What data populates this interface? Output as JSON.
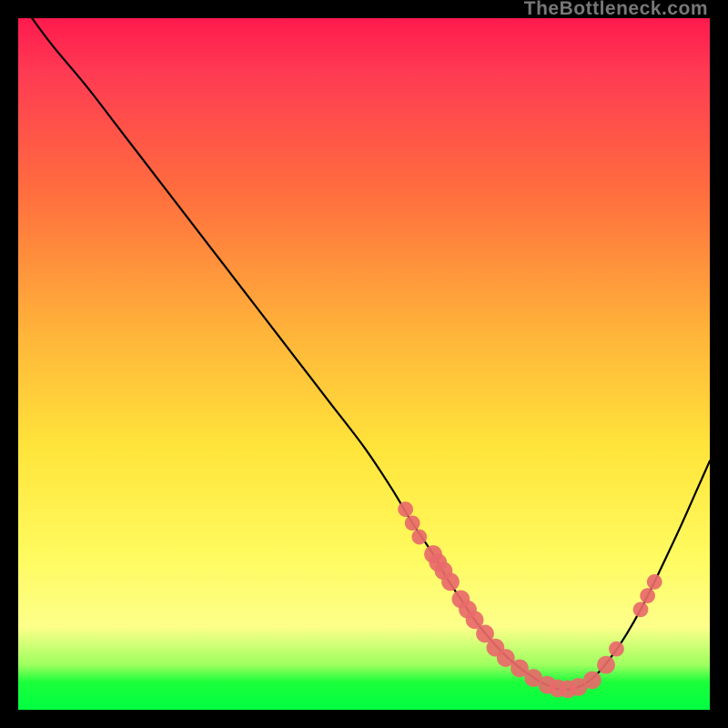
{
  "attribution": "TheBottleneck.com",
  "chart_data": {
    "type": "line",
    "title": "",
    "xlabel": "",
    "ylabel": "",
    "xlim": [
      0,
      100
    ],
    "ylim": [
      0,
      100
    ],
    "grid": false,
    "legend": false,
    "series": [
      {
        "name": "curve",
        "x": [
          2,
          5,
          10,
          15,
          20,
          25,
          30,
          35,
          40,
          45,
          50,
          54,
          57,
          60,
          62,
          64,
          66,
          68,
          70,
          72,
          74,
          76,
          78,
          80,
          82,
          84,
          86,
          88,
          90,
          92,
          94,
          96,
          98,
          100
        ],
        "values": [
          100,
          96,
          90,
          83.5,
          77,
          70.5,
          64,
          57.5,
          51,
          44.5,
          38,
          32,
          27,
          22.5,
          19,
          16,
          13,
          10.5,
          8.3,
          6.5,
          5,
          3.8,
          3,
          3,
          3.8,
          5.5,
          8,
          11,
          14.5,
          18.5,
          22.7,
          27,
          31.5,
          36
        ]
      }
    ],
    "markers": [
      {
        "x": 56,
        "y": 29,
        "r": 1.1
      },
      {
        "x": 57,
        "y": 27,
        "r": 1.1
      },
      {
        "x": 58,
        "y": 25,
        "r": 1.1
      },
      {
        "x": 60,
        "y": 22.5,
        "r": 1.3
      },
      {
        "x": 60.7,
        "y": 21.3,
        "r": 1.3
      },
      {
        "x": 61.5,
        "y": 20.1,
        "r": 1.3
      },
      {
        "x": 62.5,
        "y": 18.5,
        "r": 1.3
      },
      {
        "x": 64,
        "y": 16,
        "r": 1.3
      },
      {
        "x": 65,
        "y": 14.5,
        "r": 1.3
      },
      {
        "x": 66,
        "y": 13,
        "r": 1.3
      },
      {
        "x": 67.5,
        "y": 11,
        "r": 1.3
      },
      {
        "x": 69,
        "y": 9,
        "r": 1.3
      },
      {
        "x": 70.5,
        "y": 7.5,
        "r": 1.3
      },
      {
        "x": 72.5,
        "y": 6,
        "r": 1.3
      },
      {
        "x": 74.5,
        "y": 4.6,
        "r": 1.3
      },
      {
        "x": 76.5,
        "y": 3.6,
        "r": 1.3
      },
      {
        "x": 78,
        "y": 3.1,
        "r": 1.3
      },
      {
        "x": 79.5,
        "y": 3,
        "r": 1.3
      },
      {
        "x": 81,
        "y": 3.3,
        "r": 1.3
      },
      {
        "x": 83,
        "y": 4.3,
        "r": 1.3
      },
      {
        "x": 85,
        "y": 6.5,
        "r": 1.3
      },
      {
        "x": 86.5,
        "y": 8.8,
        "r": 1.1
      },
      {
        "x": 90,
        "y": 14.5,
        "r": 1.1
      },
      {
        "x": 91,
        "y": 16.5,
        "r": 1.1
      },
      {
        "x": 92,
        "y": 18.5,
        "r": 1.1
      }
    ],
    "marker_color": "#e86a6a",
    "curve_color": "#000000",
    "background_gradient": {
      "top": "#ff1a4d",
      "mid1": "#ff6d3e",
      "mid2": "#ffe43a",
      "mid3": "#fffb60",
      "bottom": "#00ff41"
    }
  }
}
